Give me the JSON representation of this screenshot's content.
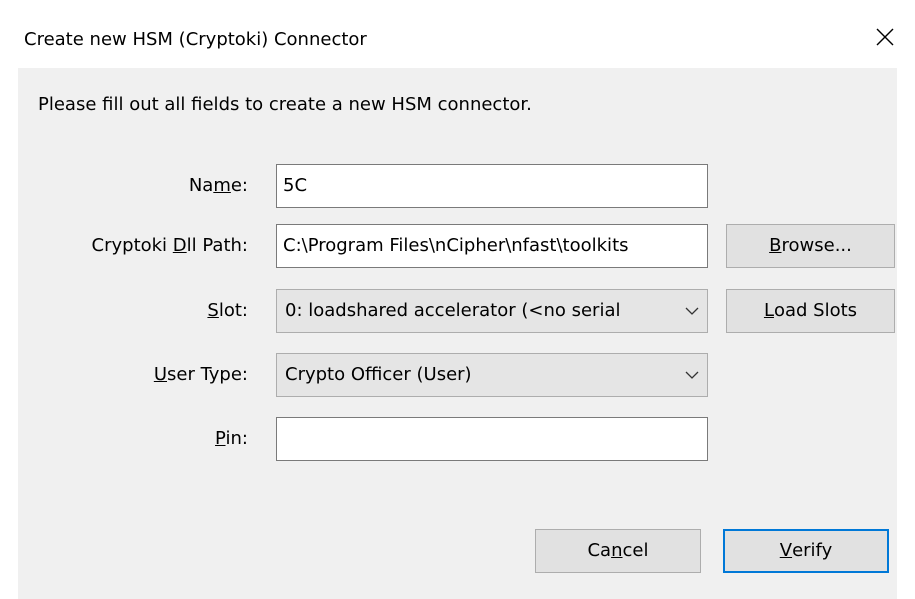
{
  "window": {
    "title": "Create new HSM (Cryptoki) Connector",
    "close_glyph": "✕"
  },
  "instructions": "Please fill out all fields to create a new HSM connector.",
  "fields": {
    "name": {
      "label_pre": "Na",
      "label_mnemonic": "m",
      "label_post": "e:",
      "value": "5C"
    },
    "dll_path": {
      "label_pre": "Cryptoki ",
      "label_mnemonic": "D",
      "label_post": "ll Path:",
      "value": "C:\\Program Files\\nCipher\\nfast\\toolkits"
    },
    "slot": {
      "label_pre": "",
      "label_mnemonic": "S",
      "label_post": "lot:",
      "selected": "0: loadshared accelerator (<no serial"
    },
    "user_type": {
      "label_pre": "",
      "label_mnemonic": "U",
      "label_post": "ser Type:",
      "selected": "Crypto Officer (User)"
    },
    "pin": {
      "label_pre": "",
      "label_mnemonic": "P",
      "label_post": "in:",
      "value": ""
    }
  },
  "buttons": {
    "browse": {
      "pre": "",
      "mnemonic": "B",
      "post": "rowse..."
    },
    "load_slots": {
      "pre": "",
      "mnemonic": "L",
      "post": "oad Slots"
    },
    "cancel": {
      "pre": "Ca",
      "mnemonic": "n",
      "post": "cel"
    },
    "verify": {
      "pre": "",
      "mnemonic": "V",
      "post": "erify"
    }
  },
  "icons": {
    "close": "close-icon",
    "dropdown": "chevron-down-icon"
  },
  "colors": {
    "client_bg": "#f0f0f0",
    "button_bg": "#e1e1e1",
    "default_border": "#0078d7",
    "combo_bg": "#e5e5e5"
  }
}
